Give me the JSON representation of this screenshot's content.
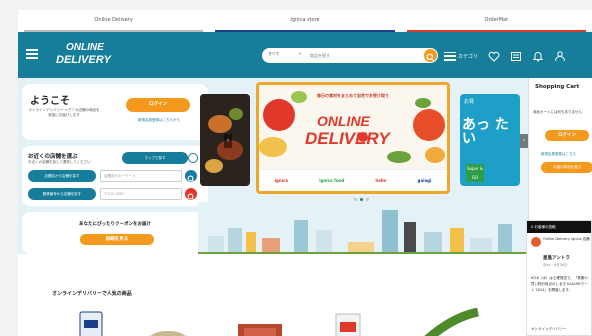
{
  "service_tabs": [
    {
      "label": "Online Delivery",
      "color": "#b9b9b9"
    },
    {
      "label": "Ignica store",
      "color": "#1b3f8b"
    },
    {
      "label": "OrderMat",
      "color": "#e0392b"
    }
  ],
  "header": {
    "logo_line1": "ONLINE",
    "logo_line2": "DELIVERY",
    "search_category": "すべて",
    "search_placeholder": "商品を探す",
    "category_label": "カテゴリ"
  },
  "welcome": {
    "greeting": "ようこそ",
    "description": "オンラインデリバリー イグニカ店舗の商品を 家族にお届けします",
    "login_label": "ログイン",
    "register_label": "新規会員登録はこちらから"
  },
  "store_finder": {
    "title": "お近くの店舗を選ぶ",
    "subtitle": "お近くの店舗を探して選択してください",
    "map_button": "マップで探す",
    "by_name_button": "店舗名から店舗を探す",
    "name_placeholder": "店舗名やキーワード",
    "by_zip_button": "郵便番号から店舗を探す",
    "zip_placeholder": "〒123-4567"
  },
  "coupon": {
    "title": "あなたにぴったりクーポンをお届け",
    "button": "詳細を見る"
  },
  "banner": {
    "tagline": "毎日の食材をまとめて自宅でお受け取り",
    "title_line1": "ONLINE",
    "title_line2": "DELIVERY",
    "stores": [
      "ignica",
      "ignica food",
      "hello",
      "gaiagi"
    ],
    "right_badge": "お買",
    "right_text": "あっ たい",
    "right_label": "Super & GO"
  },
  "cart": {
    "title": "Shopping Cart",
    "message": "商品カートには何もありません",
    "login_label": "ログイン",
    "register_label": "新規会員登録はこちら",
    "order_button": "お届け商品を選ぶ"
  },
  "feed": {
    "header": "X お客様の投稿",
    "account_name": "Online Delivery Ignica 店舗",
    "username": "星島アントラ",
    "post_date": "@xx · 6月26日",
    "post_text": "6/26（水）は土曜発送で、「長期の買い物分岐点のしるき KASUMIマート 2024」を開催します。",
    "footer": "オンラインデリバリー"
  },
  "products": {
    "title": "オンラインデリバリーで人気の商品"
  },
  "colors": {
    "header_teal": "#167e9a",
    "accent_orange": "#f39a1e",
    "alert_red": "#e0392b"
  }
}
